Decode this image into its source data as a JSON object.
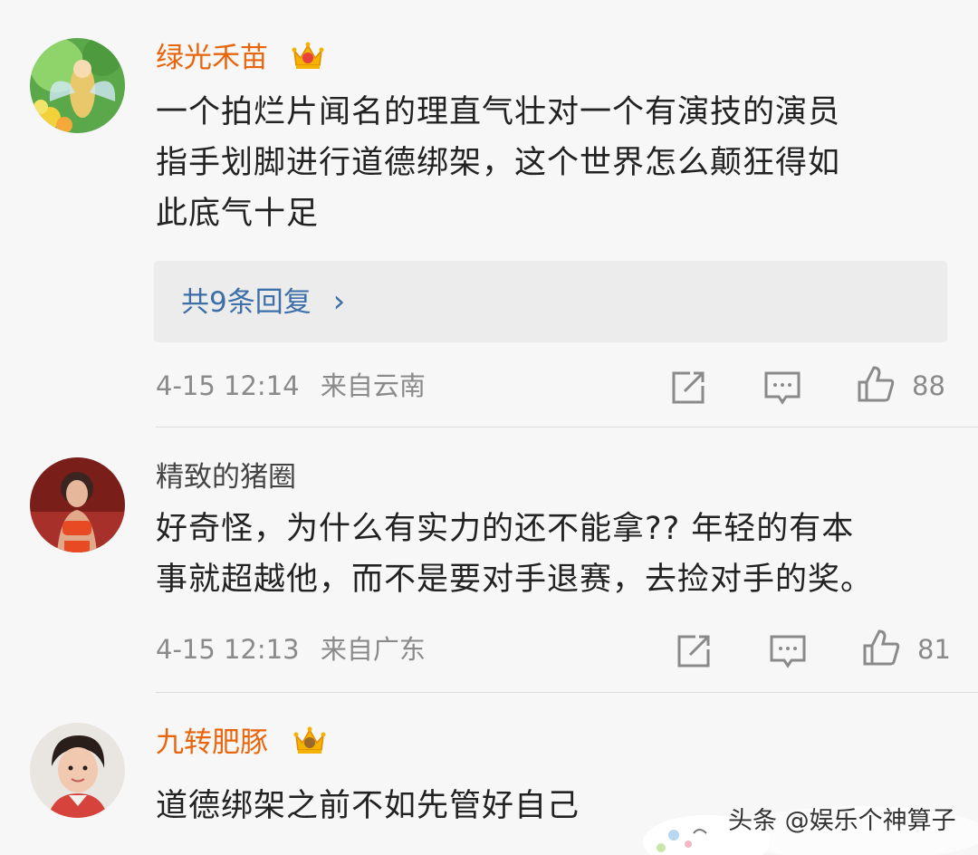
{
  "comments": [
    {
      "username": "绿光禾苗",
      "vip": true,
      "text_lines": [
        "一个拍烂片闻名的理直气壮对一个有演技的演员",
        "指手划脚进行道德绑架，这个世界怎么颠狂得如",
        "此底气十足"
      ],
      "replies_label": "共9条回复",
      "replies_chevron": "›",
      "date": "4-15 12:14",
      "location": "来自云南",
      "likes": "88"
    },
    {
      "username": "精致的猪圈",
      "vip": false,
      "text_lines": [
        "好奇怪，为什么有实力的还不能拿?? 年轻的有本",
        "事就超越他，而不是要对手退赛，去捡对手的奖。"
      ],
      "date": "4-15 12:13",
      "location": "来自广东",
      "likes": "81"
    },
    {
      "username": "九转肥豚",
      "vip": true,
      "text_lines": [
        "道德绑架之前不如先管好自己"
      ]
    }
  ],
  "watermark": {
    "text": "头条 @娱乐个神算子"
  },
  "icons": {
    "vip": "crown-icon",
    "repost": "repost-icon",
    "comment": "comment-icon",
    "like": "thumbs-up-icon"
  },
  "colors": {
    "vip_name": "#e8650c",
    "plain_name": "#444444",
    "reply_link": "#3d6fa8",
    "meta": "#8a8a8a",
    "background": "#f7f7f7"
  }
}
